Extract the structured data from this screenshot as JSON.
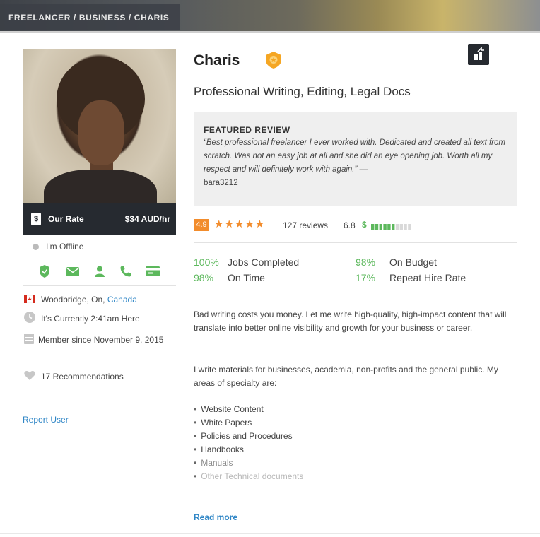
{
  "breadcrumb": {
    "items": [
      "FREELANCER",
      "BUSINESS",
      "CHARIS"
    ],
    "sep": "/"
  },
  "profile": {
    "name": "Charis",
    "headline": "Professional Writing, Editing, Legal Docs",
    "rate_label": "Our Rate",
    "rate_value": "$34 AUD/hr",
    "status": "I'm Offline",
    "location_city": "Woodbridge, On,",
    "location_country": "Canada",
    "local_time": "It's Currently 2:41am Here",
    "member_since": "Member since November 9, 2015",
    "recommendations": "17 Recommendations",
    "report": "Report User"
  },
  "review": {
    "title": "FEATURED REVIEW",
    "body": "“Best professional freelancer I ever worked with. Dedicated and created all text from scratch. Was not an easy job at all and she did an eye opening job. Worth all my respect and will definitely work with again.” —",
    "user": "bara3212"
  },
  "rating": {
    "score": "4.9",
    "stars": "★★★★★",
    "star_count": 5,
    "reviews": "127 reviews",
    "earnings_score": "6.8",
    "earnings_symbol": "$",
    "earnings_level": 0.6
  },
  "stats": [
    {
      "pct": "100%",
      "label": "Jobs Completed"
    },
    {
      "pct": "98%",
      "label": "On Budget"
    },
    {
      "pct": "98%",
      "label": "On Time"
    },
    {
      "pct": "17%",
      "label": "Repeat Hire Rate"
    }
  ],
  "description": {
    "p1": "Bad writing costs you money. Let me write high-quality, high-impact content that will translate into better online visibility and growth for your business or career.",
    "p2": "I write materials for businesses, academia, non-profits and the general public. My areas of specialty are:",
    "bullets": [
      "Website Content",
      "White Papers",
      "Policies and Procedures",
      "Handbooks",
      "Manuals",
      "Other Technical documents"
    ],
    "read_more": "Read more"
  },
  "colors": {
    "accent_green": "#5cb85c",
    "link_blue": "#2f86c6",
    "star_orange": "#f28c2c",
    "dark_bar": "#262a30"
  },
  "icons": [
    "shield-icon",
    "mail-icon",
    "user-icon",
    "phone-icon",
    "card-icon",
    "flag-canada-icon",
    "clock-icon",
    "calendar-icon",
    "heart-icon",
    "share-icon",
    "badge-icon"
  ]
}
